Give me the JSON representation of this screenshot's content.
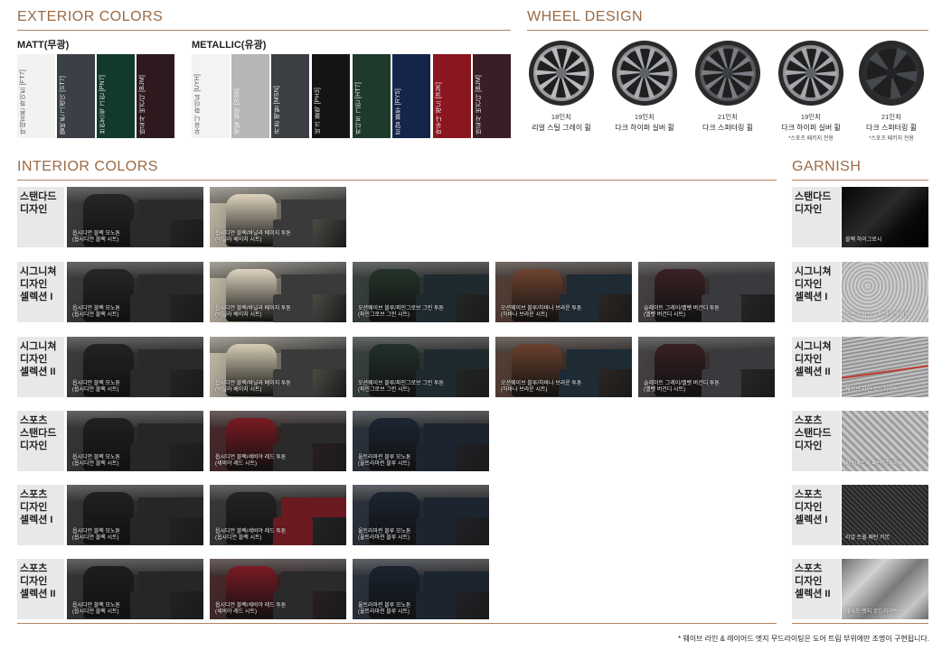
{
  "exterior": {
    "title": "EXTERIOR COLORS",
    "matt_label": "MATT(무광)",
    "metallic_label": "METALLIC(유광)",
    "matt": [
      {
        "label": "마테호른 화이트 [FT7]",
        "color": "#f2f2f0",
        "text": "#555555"
      },
      {
        "label": "멜버른 그레이 [ST7]",
        "color": "#3a4045",
        "text": "#e6e6e6"
      },
      {
        "label": "브런즈윅 그린 [PN7]",
        "color": "#123a2c",
        "text": "#e6e6e6"
      },
      {
        "label": "바로사 버건디 [BJM]",
        "color": "#2e1a1e",
        "text": "#e6e6e6"
      }
    ],
    "metallic": [
      {
        "label": "우유니 화이트 [UYH]",
        "color": "#f3f3f3",
        "text": "#555555"
      },
      {
        "label": "세빌 실버 [SS5]",
        "color": "#b6b6b6",
        "text": "#f4f4f4"
      },
      {
        "label": "카본 메탈 [MSN]",
        "color": "#3b3f44",
        "text": "#e6e6e6"
      },
      {
        "label": "비크 블랙 [PH3]",
        "color": "#141414",
        "text": "#e0e0e0"
      },
      {
        "label": "카디프 그린 [HT7]",
        "color": "#1f3a2b",
        "text": "#e6e6e6"
      },
      {
        "label": "로얄 블루 [RY5]",
        "color": "#14244a",
        "text": "#e6e6e6"
      },
      {
        "label": "마우나 레드 [RJK]",
        "color": "#8a1620",
        "text": "#f0f0f0"
      },
      {
        "label": "바로사 버건디 [BJM]",
        "color": "#3a1e26",
        "text": "#e6e6e6"
      }
    ]
  },
  "wheels": {
    "title": "WHEEL DESIGN",
    "items": [
      {
        "size": "18인치",
        "name": "리얼 스틸 그레이 휠",
        "note": "",
        "rim": "#9a9ca0",
        "spoke": "#b9bbbf",
        "hub": "#6d7075"
      },
      {
        "size": "19인치",
        "name": "다크 하이퍼 실버 휠",
        "note": "",
        "rim": "#8e9094",
        "spoke": "#a8abb0",
        "hub": "#5e6166"
      },
      {
        "size": "21인치",
        "name": "다크 스퍼터링 휠",
        "note": "",
        "rim": "#55585c",
        "spoke": "#7a7d82",
        "hub": "#3a3d41"
      },
      {
        "size": "19인치",
        "name": "다크 하이퍼 실버 휠",
        "note": "*스포츠 패키지 전용",
        "rim": "#8e9094",
        "spoke": "#a4a7ac",
        "hub": "#5e6166"
      },
      {
        "size": "21인치",
        "name": "다크 스퍼터링 휠",
        "note": "*스포츠 패키지 전용",
        "rim": "#2b2d30",
        "spoke": "#45484c",
        "hub": "#222426"
      }
    ]
  },
  "interior": {
    "title": "INTERIOR COLORS",
    "rows": [
      {
        "label": "스탠다드\n디자인",
        "items": [
          {
            "cap1": "옵시디언 블랙 모노톤",
            "cap2": "(옵시디언 블랙 시트)",
            "seat": "#262626",
            "bg": "#3e3e3e",
            "dash": "#2a2a2a"
          },
          {
            "cap1": "옵시디언 블랙/바닐라 베이지 투톤",
            "cap2": "(바닐라 베이지 시트)",
            "seat": "#ddd3bd",
            "bg": "#c9c0ac",
            "dash": "#3a3a3a"
          }
        ]
      },
      {
        "label": "시그니쳐\n디자인\n셀렉션 I",
        "items": [
          {
            "cap1": "옵시디언 블랙 모노톤",
            "cap2": "(옵시디언 블랙 시트)",
            "seat": "#262626",
            "bg": "#3e3e3e",
            "dash": "#2a2a2a"
          },
          {
            "cap1": "옵시디언 블랙/바닐라 베이지 투톤",
            "cap2": "(바닐라 베이지 시트)",
            "seat": "#ddd3bd",
            "bg": "#c9c0ac",
            "dash": "#3a3a3a"
          },
          {
            "cap1": "오션웨이브 블루/파인그로브 그린 투톤",
            "cap2": "(파인그로브 그린 시트)",
            "seat": "#24332a",
            "bg": "#3a4440",
            "dash": "#1e2a2e"
          },
          {
            "cap1": "오션웨이브 블루/하바나 브라운 투톤",
            "cap2": "(하바나 브라운 시트)",
            "seat": "#6e4330",
            "bg": "#5a4238",
            "dash": "#1e2a34"
          },
          {
            "cap1": "슬레이트 그레이/벨벳 버건디 투톤",
            "cap2": "(벨벳 버건디 시트)",
            "seat": "#3a2226",
            "bg": "#4a4446",
            "dash": "#3a3a3e"
          }
        ]
      },
      {
        "label": "시그니쳐\n디자인\n셀렉션 II",
        "items": [
          {
            "cap1": "옵시디언 블랙 모노톤",
            "cap2": "(옵시디언 블랙 시트)",
            "seat": "#232323",
            "bg": "#3e3e3e",
            "dash": "#2a2a2a"
          },
          {
            "cap1": "옵시디언 블랙/바닐라 베이지 투톤",
            "cap2": "(바닐라 베이지 시트)",
            "seat": "#d8ceb6",
            "bg": "#c9c0ac",
            "dash": "#3a3a3a"
          },
          {
            "cap1": "오션웨이브 블루/파인그로브 그린 투톤",
            "cap2": "(파인그로브 그린 시트)",
            "seat": "#22312a",
            "bg": "#3a4440",
            "dash": "#1e2a2e"
          },
          {
            "cap1": "오션웨이브 블루/하바나 브라운 투톤",
            "cap2": "(하바나 브라운 시트)",
            "seat": "#6a412e",
            "bg": "#5a4238",
            "dash": "#1e2a34"
          },
          {
            "cap1": "슬레이트 그레이/벨벳 버건디 투톤",
            "cap2": "(벨벳 버건디 시트)",
            "seat": "#382024",
            "bg": "#4a4446",
            "dash": "#3a3a3e"
          }
        ]
      },
      {
        "label": "스포츠\n스탠다드\n디자인",
        "items": [
          {
            "cap1": "옵시디언 블랙 모노톤",
            "cap2": "(옵시디언 블랙 시트)",
            "seat": "#202020",
            "bg": "#383838",
            "dash": "#262626"
          },
          {
            "cap1": "옵시디언 블랙/세비야 레드 투톤",
            "cap2": "(세비야 레드 시트)",
            "seat": "#7a1a22",
            "bg": "#4a2a2c",
            "dash": "#2a2a2a"
          },
          {
            "cap1": "울트라마린 블루 모노톤",
            "cap2": "(울트라마린 블루 시트)",
            "seat": "#1c2532",
            "bg": "#2c3440",
            "dash": "#1c2430"
          }
        ]
      },
      {
        "label": "스포츠\n디자인\n셀렉션 I",
        "items": [
          {
            "cap1": "옵시디언 블랙 모노톤",
            "cap2": "(옵시디언 블랙 시트)",
            "seat": "#202020",
            "bg": "#383838",
            "dash": "#262626"
          },
          {
            "cap1": "옵시디언 블랙/세비야 레드 투톤",
            "cap2": "(옵시디언 블랙 시트)",
            "seat": "#242424",
            "bg": "#3a3a3a",
            "dash": "#6a1a20"
          },
          {
            "cap1": "울트라마린 블루 모노톤",
            "cap2": "(울트라마린 블루 시트)",
            "seat": "#1c2532",
            "bg": "#2c3440",
            "dash": "#1c2430"
          }
        ]
      },
      {
        "label": "스포츠\n디자인\n셀렉션 II",
        "items": [
          {
            "cap1": "옵시디언 블랙 모노톤",
            "cap2": "(옵시디언 블랙 시트)",
            "seat": "#1e1e1e",
            "bg": "#363636",
            "dash": "#262626"
          },
          {
            "cap1": "옵시디언 블랙/세비야 레드 투톤",
            "cap2": "(세비야 레드 시트)",
            "seat": "#7a1a22",
            "bg": "#4a2a2c",
            "dash": "#2a2a2a"
          },
          {
            "cap1": "울트라마린 블루 모노톤",
            "cap2": "(울트라마린 블루 시트)",
            "seat": "#1a2330",
            "bg": "#2c3440",
            "dash": "#1c2430"
          }
        ]
      }
    ]
  },
  "garnish": {
    "title": "GARNISH",
    "items": [
      {
        "label": "스탠다드\n디자인",
        "cap": "블랙 하이그로시",
        "kind": "gloss"
      },
      {
        "label": "시그니쳐\n디자인\n셀렉션 I",
        "cap": "스핀 브러쉬드 패턴 알루미늄",
        "kind": "brushed"
      },
      {
        "label": "시그니쳐\n디자인\n셀렉션 II",
        "cap": "웨이브 라인 무드라이팅*",
        "kind": "wave"
      },
      {
        "label": "스포츠\n스탠다드\n디자인",
        "cap": "지오메트릭 패턴 알루미늄",
        "kind": "geo"
      },
      {
        "label": "스포츠\n디자인\n셀렉션 I",
        "cap": "리얼 트윌 패턴 카본",
        "kind": "carbon"
      },
      {
        "label": "스포츠\n디자인\n셀렉션 II",
        "cap": "레이드 엣지 무드라이팅*",
        "kind": "edge"
      }
    ]
  },
  "footnote": "* 웨이브 라인 & 레이어드 엣지 무드라이팅은 도어 트림 부위에만 조명이 구현됩니다."
}
